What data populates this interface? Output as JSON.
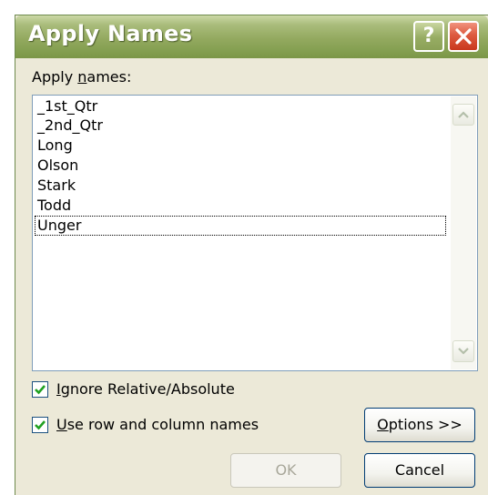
{
  "dialog": {
    "title": "Apply Names",
    "help_label": "?"
  },
  "apply_names": {
    "label_prefix": "Apply ",
    "label_accel": "n",
    "label_rest": "ames:",
    "items": [
      "_1st_Qtr",
      "_2nd_Qtr",
      "Long",
      "Olson",
      "Stark",
      "Todd",
      "Unger"
    ],
    "focused_item": "Unger"
  },
  "options": {
    "ignore_relative": {
      "checked": true,
      "accel": "I",
      "rest": "gnore Relative/Absolute"
    },
    "use_row_column": {
      "checked": true,
      "accel": "U",
      "rest": "se row and column names"
    }
  },
  "buttons": {
    "options": {
      "accel": "O",
      "rest": "ptions >>"
    },
    "ok": "OK",
    "cancel": "Cancel"
  },
  "colors": {
    "titlebar": "#93a95f",
    "close": "#dd5a3f",
    "dialog_bg": "#ece9d8",
    "check": "#21a121"
  },
  "icons": {
    "help": "question-mark",
    "close": "x",
    "scroll_up": "chevron-up",
    "scroll_down": "chevron-down",
    "check": "checkmark"
  }
}
